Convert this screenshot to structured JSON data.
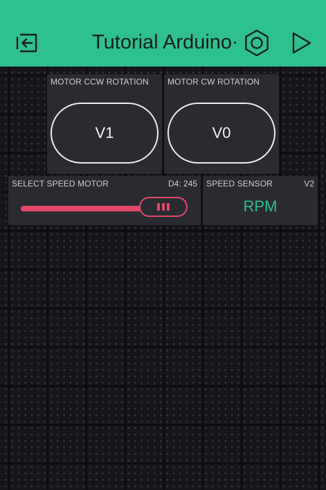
{
  "header": {
    "title": "Tutorial Arduino",
    "back_icon": "exit-icon",
    "settings_icon": "hexagon-nut-icon",
    "play_icon": "play-icon",
    "background_color": "#2fc08f"
  },
  "widgets": {
    "ccw_button": {
      "label": "MOTOR CCW ROTATION",
      "button_text": "V1"
    },
    "cw_button": {
      "label": "MOTOR CW ROTATION",
      "button_text": "V0"
    },
    "speed_slider": {
      "label": "SELECT SPEED MOTOR",
      "pin": "D4: 245",
      "value": 245,
      "color": "#e3486a"
    },
    "speed_sensor": {
      "label": "SPEED SENSOR",
      "pin": "V2",
      "value": "RPM",
      "color": "#2fc08f"
    }
  }
}
